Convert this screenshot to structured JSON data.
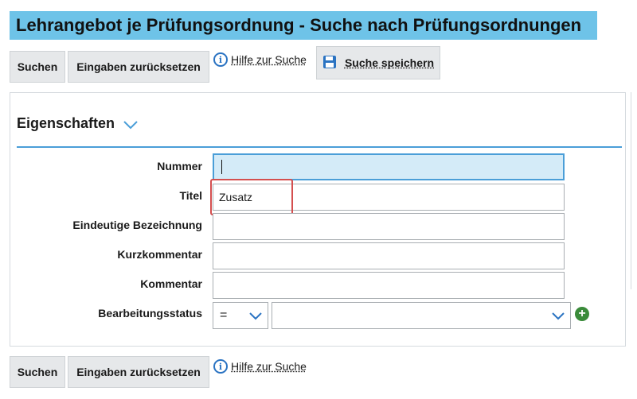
{
  "page_title": "Lehrangebot je Prüfungsordnung - Suche nach Prüfungsordnungen",
  "toolbar_top": {
    "search_label": "Suchen",
    "reset_label": "Eingaben zurücksetzen",
    "help_label": "Hilfe zur Suche",
    "save_search_label": "Suche speichern"
  },
  "section": {
    "title": "Eigenschaften"
  },
  "fields": {
    "nummer": {
      "label": "Nummer",
      "value": ""
    },
    "titel": {
      "label": "Titel",
      "value": "Zusatz"
    },
    "eindeutige_bezeichnung": {
      "label": "Eindeutige Bezeichnung",
      "value": ""
    },
    "kurzkommentar": {
      "label": "Kurzkommentar",
      "value": ""
    },
    "kommentar": {
      "label": "Kommentar",
      "value": ""
    },
    "bearbeitungsstatus": {
      "label": "Bearbeitungsstatus",
      "operator": "=",
      "value": ""
    }
  },
  "toolbar_bottom": {
    "search_label": "Suchen",
    "reset_label": "Eingaben zurücksetzen",
    "help_label": "Hilfe zur Suche"
  },
  "icons": {
    "help": "info-circle-icon",
    "save": "floppy-disk-icon",
    "expand": "chevron-down-icon",
    "add": "plus-circle-icon"
  },
  "colors": {
    "title_bg": "#6ec3e8",
    "accent": "#4a9ed8",
    "highlight": "#d44f4f",
    "add": "#3a8b3a"
  }
}
